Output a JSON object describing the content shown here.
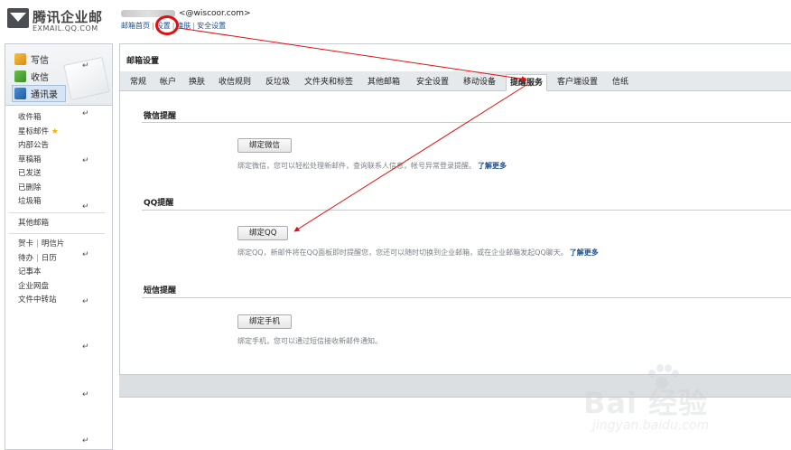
{
  "header": {
    "logo_name": "腾讯企业邮",
    "logo_sub": "EXMAIL.QQ.COM",
    "account_prefix": "<",
    "account_email": "@wiscoor.com>",
    "links": [
      "邮箱首页",
      "设置",
      "换肤",
      "安全设置"
    ]
  },
  "sidebar": {
    "actions": [
      {
        "label": "写信",
        "icon": "pencil-icon"
      },
      {
        "label": "收信",
        "icon": "inbox-download-icon"
      },
      {
        "label": "通讯录",
        "icon": "contacts-icon"
      }
    ],
    "folders": [
      "收件箱",
      "星标邮件",
      "内部公告",
      "草稿箱",
      "已发送",
      "已删除",
      "垃圾箱"
    ],
    "other": "其他邮箱",
    "tools_row1": [
      "贺卡",
      "明信片"
    ],
    "tools_row2": [
      "待办",
      "日历"
    ],
    "tools": [
      "记事本",
      "企业网盘",
      "文件中转站"
    ],
    "return_symbol": "↵"
  },
  "main": {
    "title": "邮箱设置",
    "tabs": [
      "常规",
      "帐户",
      "换肤",
      "收信规则",
      "反垃圾",
      "文件夹和标签",
      "其他邮箱",
      "安全设置",
      "移动设备",
      "提醒服务",
      "客户端设置",
      "信纸"
    ],
    "active_tab": "提醒服务",
    "sections": [
      {
        "title": "微信提醒",
        "button": "绑定微信",
        "desc": "绑定微信，您可以轻松处理新邮件，查询联系人信息，帐号异常登录提醒。",
        "more": "了解更多"
      },
      {
        "title": "QQ提醒",
        "button": "绑定QQ",
        "desc": "绑定QQ，新邮件将在QQ面板即时提醒您，您还可以随时切换到企业邮箱，或在企业邮箱发起QQ聊天。",
        "more": "了解更多"
      },
      {
        "title": "短信提醒",
        "button": "绑定手机",
        "desc": "绑定手机，您可以通过短信接收新邮件通知。",
        "more": ""
      }
    ]
  },
  "watermark": {
    "logo": "Bai  经验",
    "url": "jingyan.baidu.com"
  },
  "colors": {
    "annotation_red": "#e01010",
    "link_blue": "#1e4f8e",
    "tab_bar": "#e6e9ec"
  }
}
